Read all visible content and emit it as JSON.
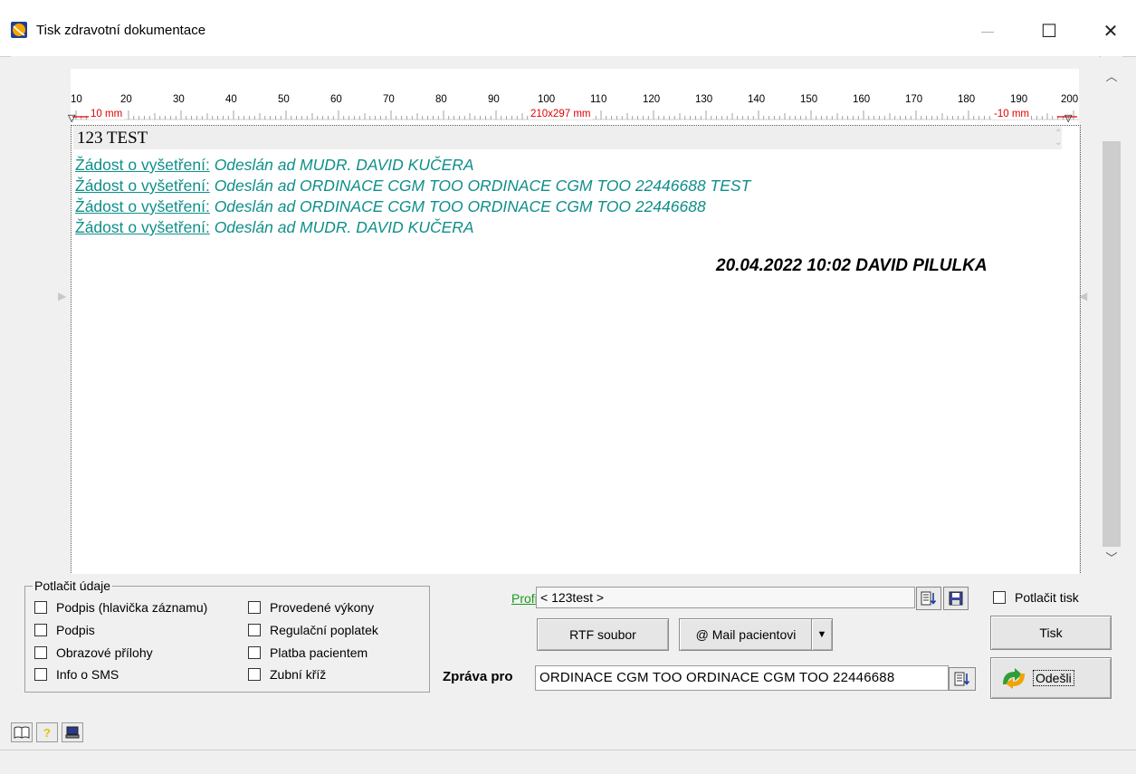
{
  "window": {
    "title": "Tisk zdravotní dokumentace",
    "minimize": "—",
    "maximize": "☐",
    "close": "✕"
  },
  "ruler": {
    "ticks": [
      "10",
      "20",
      "30",
      "40",
      "50",
      "60",
      "70",
      "80",
      "90",
      "100",
      "110",
      "120",
      "130",
      "140",
      "150",
      "160",
      "170",
      "180",
      "190",
      "200"
    ],
    "left_margin": "10 mm",
    "paper": "210x297 mm",
    "right_margin": "-10 mm"
  },
  "document": {
    "header": "123 TEST",
    "entries": [
      {
        "link": "Žádost o vyšetření:",
        "text": " Odeslán ad MUDR. DAVID KUČERA"
      },
      {
        "link": "Žádost o vyšetření:",
        "text": " Odeslán ad ORDINACE CGM TOO ORDINACE CGM TOO 22446688 TEST"
      },
      {
        "link": "Žádost o vyšetření:",
        "text": " Odeslán ad ORDINACE CGM TOO ORDINACE CGM TOO 22446688"
      },
      {
        "link": "Žádost o vyšetření:",
        "text": " Odeslán ad MUDR. DAVID KUČERA"
      }
    ],
    "signature": "20.04.2022 10:02 DAVID PILULKA"
  },
  "suppress": {
    "legend": "Potlačit údaje",
    "col1": [
      "Podpis (hlavička záznamu)",
      "Podpis",
      "Obrazové přílohy",
      "Info o SMS"
    ],
    "col2": [
      "Provedené výkony",
      "Regulační poplatek",
      "Platba pacientem",
      "Zubní kříž"
    ]
  },
  "profile": {
    "label": "Profil",
    "value": "< 123test >"
  },
  "buttons": {
    "rtf": "RTF soubor",
    "mail": "@ Mail pacientovi",
    "tisk": "Tisk",
    "odesli": "Odešli",
    "potlacit_tisk": "Potlačit tisk"
  },
  "message": {
    "label": "Zpráva pro",
    "value": "ORDINACE CGM TOO ORDINACE CGM TOO 22446688"
  },
  "colors": {
    "link": "#0f8f8a",
    "ruler_red": "#e00000",
    "profil_green": "#1a9a1a"
  }
}
